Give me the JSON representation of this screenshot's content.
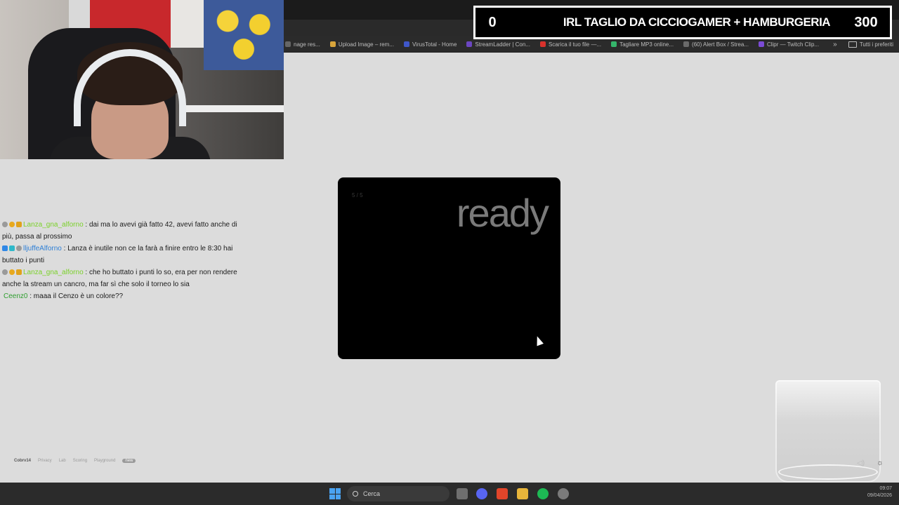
{
  "overlay": {
    "left_value": "0",
    "title": "IRL TAGLIO DA CICCIOGAMER + HAMBURGERIA",
    "right_value": "300"
  },
  "bookmarks": [
    {
      "label": "nage res...",
      "color": "#666666"
    },
    {
      "label": "Upload Image – rem...",
      "color": "#d9a53b"
    },
    {
      "label": "VirusTotal - Home",
      "color": "#3f57c9"
    },
    {
      "label": "StreamLadder | Con...",
      "color": "#6b46c1"
    },
    {
      "label": "Scarica il tuo file —...",
      "color": "#d9322c"
    },
    {
      "label": "Tagliare MP3 online...",
      "color": "#35b56b"
    },
    {
      "label": "(60) Alert Box / Strea...",
      "color": "#6a6a6a"
    },
    {
      "label": "Clipr — Twitch Clip...",
      "color": "#7b4bd6"
    }
  ],
  "bookmarks_folder": "Tutti i preferiti",
  "chat": [
    {
      "username": "Lanza_gna_alforno",
      "user_color": "#7bd12a",
      "badges": [
        "#9a9a9a",
        "#e8a91e",
        "#e0a21c"
      ],
      "text": ": dai ma lo avevi già fatto 42, avevi fatto anche di più, passa al prossimo"
    },
    {
      "username": "lljuffeAlforno",
      "user_color": "#2e7fd6",
      "badges": [
        "#2f87e6",
        "#2fb8c9",
        "#9a9a9a"
      ],
      "text": ": Lanza è inutile non ce la farà a finire entro le 8:30 hai buttato i punti"
    },
    {
      "username": "Lanza_gna_alforno",
      "user_color": "#7bd12a",
      "badges": [
        "#9a9a9a",
        "#e8a91e",
        "#e0a21c"
      ],
      "text": ": che ho buttato i punti lo so, era per non rendere anche la stream un cancro, ma far sì che solo il torneo lo sia"
    },
    {
      "username": "Ceenz0",
      "user_color": "#2f9e2f",
      "badges": [],
      "text": ": maaa il Cenzo è un colore??"
    }
  ],
  "dialog": {
    "counter": "5 / 5",
    "word": "ready"
  },
  "footer_links": {
    "brand": "Cobrv14",
    "items": [
      "Privacy",
      "Lab",
      "Scoring",
      "Playground"
    ],
    "pill": "new"
  },
  "taskbar": {
    "search_placeholder": "Cerca",
    "time": "09:07",
    "date": "09/04/2026"
  }
}
